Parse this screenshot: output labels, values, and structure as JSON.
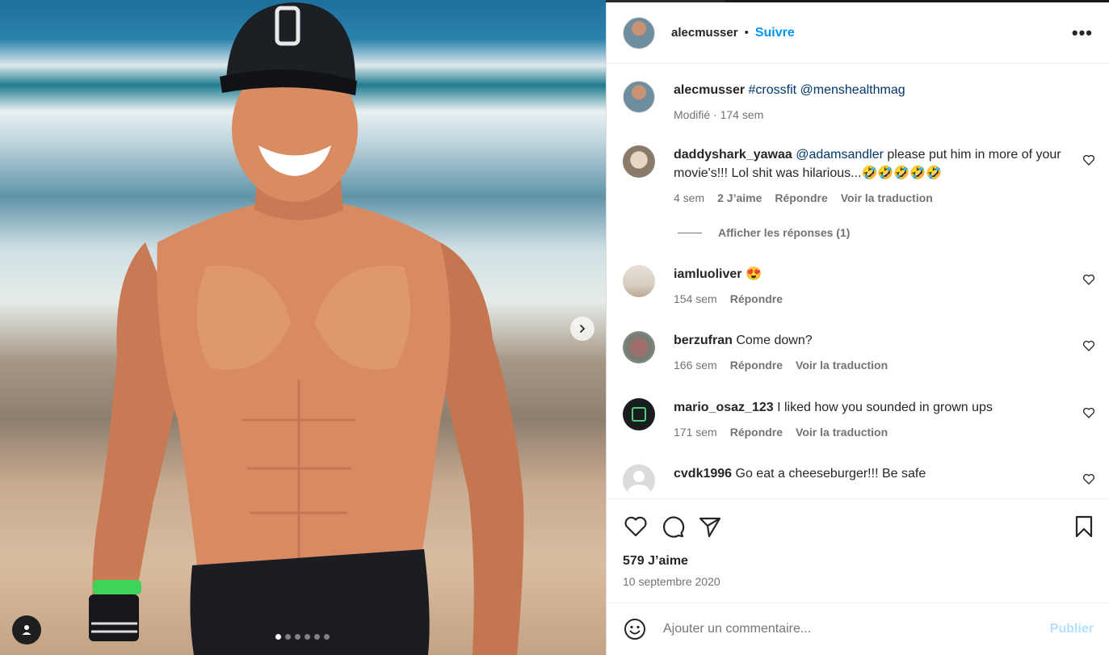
{
  "post": {
    "photo": {
      "carousel_total": 6,
      "carousel_active": 0
    },
    "author": {
      "username": "alecmusser",
      "follow_label": "Suivre",
      "separator": "•",
      "more_label": "•••"
    },
    "caption": {
      "username": "alecmusser",
      "text": "#crossfit @menshealthmag",
      "meta": "Modifié · 174 sem"
    },
    "comments": [
      {
        "username": "daddyshark_yawaa",
        "mention": "@adamsandler",
        "text": " please put him in more of your movie's!!! Lol shit was hilarious...",
        "emoji": "🤣🤣🤣🤣🤣",
        "time": "4 sem",
        "likes": "2 J’aime",
        "reply": "Répondre",
        "translate": "Voir la traduction",
        "view_replies": "Afficher les réponses (1)"
      },
      {
        "username": "iamluoliver",
        "text": "",
        "emoji": "😍",
        "time": "154 sem",
        "reply": "Répondre"
      },
      {
        "username": "berzufran",
        "text": " Come down?",
        "time": "166 sem",
        "reply": "Répondre",
        "translate": "Voir la traduction"
      },
      {
        "username": "mario_osaz_123",
        "text": " I liked how you sounded in grown ups",
        "time": "171 sem",
        "reply": "Répondre",
        "translate": "Voir la traduction"
      },
      {
        "username": "cvdk1996",
        "text": " Go eat a cheeseburger!!! Be safe"
      }
    ],
    "likes": "579 J’aime",
    "date": "10 septembre 2020",
    "add_comment": {
      "placeholder": "Ajouter un commentaire...",
      "publish": "Publier"
    }
  },
  "colors": {
    "accent": "#0095f6",
    "text": "#262626",
    "muted": "#737373",
    "publish_disabled": "#b2dffc"
  }
}
